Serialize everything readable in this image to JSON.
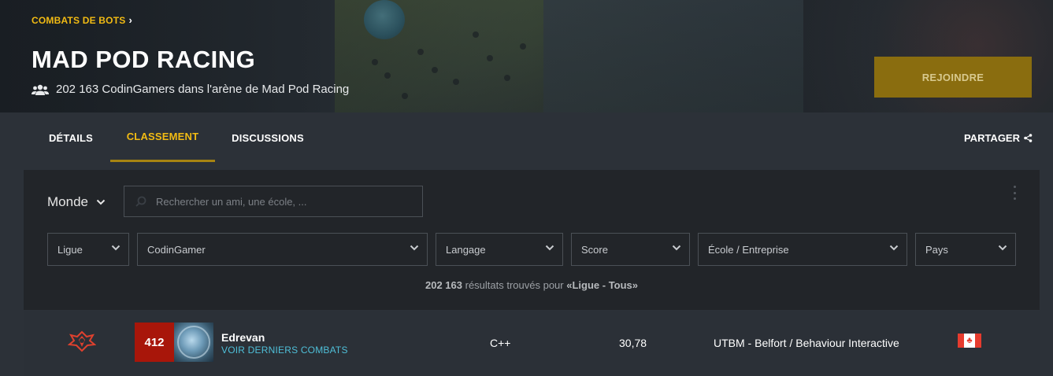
{
  "hero": {
    "breadcrumb": "COMBATS DE BOTS",
    "title": "MAD POD RACING",
    "subtitle": "202 163 CodinGamers dans l'arène de Mad Pod Racing",
    "join_label": "REJOINDRE"
  },
  "tabs": [
    {
      "label": "DÉTAILS",
      "active": false
    },
    {
      "label": "CLASSEMENT",
      "active": true
    },
    {
      "label": "DISCUSSIONS",
      "active": false
    }
  ],
  "share_label": "PARTAGER",
  "leaderboard": {
    "scope": "Monde",
    "search_placeholder": "Rechercher un ami, une école, ...",
    "filters": [
      "Ligue",
      "CodinGamer",
      "Langage",
      "Score",
      "École / Entreprise",
      "Pays"
    ],
    "results": {
      "count": "202 163",
      "text": "résultats trouvés pour",
      "query": "«Ligue - Tous»"
    },
    "rows": [
      {
        "rank": "412",
        "name": "Edrevan",
        "link": "VOIR DERNIERS COMBATS",
        "language": "C++",
        "score": "30,78",
        "school": "UTBM - Belfort / Behaviour Interactive",
        "country_icon": "canada-flag-icon",
        "league_icon": "legend-league-icon"
      }
    ]
  },
  "colors": {
    "accent": "#f2bb13",
    "join_button": "#8a6d0f",
    "rank_badge": "#a8160a",
    "link": "#4fbfd8"
  }
}
